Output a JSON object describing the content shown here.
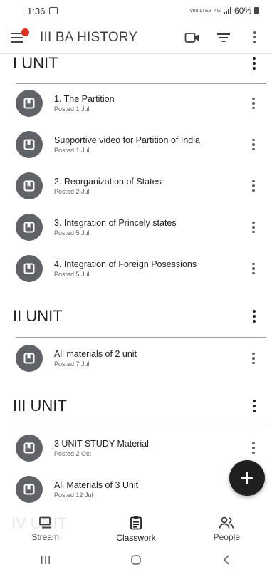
{
  "status_bar": {
    "time": "1:36",
    "network_label": "Vo0 LTE2",
    "net_type": "4G",
    "battery": "60%"
  },
  "app_bar": {
    "title": "III BA HISTORY"
  },
  "icons": {
    "menu": "menu-icon",
    "video": "video-camera-icon",
    "filter": "filter-icon",
    "more": "more-vert-icon",
    "material": "material-book-icon",
    "add": "plus-icon"
  },
  "colors": {
    "accent_dot": "#d93025",
    "icon_circle": "#5f6368",
    "fab": "#1f1f1f"
  },
  "topics": [
    {
      "title": "I UNIT",
      "items": [
        {
          "title": "1. The Partition",
          "posted": "Posted 1 Jul"
        },
        {
          "title": "Supportive video for Partition of India",
          "posted": "Posted 1 Jul"
        },
        {
          "title": "2. Reorganization of States",
          "posted": "Posted 2 Jul"
        },
        {
          "title": "3. Integration of Princely states",
          "posted": "Posted 5 Jul"
        },
        {
          "title": "4. Integration of Foreign Posessions",
          "posted": "Posted 5 Jul"
        }
      ]
    },
    {
      "title": "II UNIT",
      "items": [
        {
          "title": "All materials of 2 unit",
          "posted": "Posted 7 Jul"
        }
      ]
    },
    {
      "title": "III UNIT",
      "items": [
        {
          "title": "3 UNIT STUDY Material",
          "posted": "Posted 2 Oct"
        },
        {
          "title": "All Materials of 3 Unit",
          "posted": "Posted 12 Jul"
        }
      ]
    },
    {
      "title": "IV UNIT",
      "items": []
    }
  ],
  "bottom_nav": [
    {
      "label": "Stream",
      "icon": "stream-icon"
    },
    {
      "label": "Classwork",
      "icon": "classwork-icon",
      "active": true
    },
    {
      "label": "People",
      "icon": "people-icon"
    }
  ],
  "system_nav": [
    "recents-button",
    "home-button",
    "back-button"
  ]
}
